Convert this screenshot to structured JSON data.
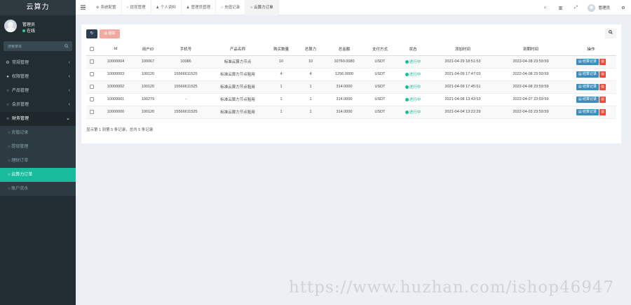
{
  "app": {
    "brand": "云算力"
  },
  "user": {
    "name": "管理员",
    "status": "在线"
  },
  "sidebar": {
    "search_placeholder": "搜索菜单",
    "menu": [
      {
        "label": "常规管理",
        "icon": "cogs-icon"
      },
      {
        "label": "权限管理",
        "icon": "group-icon"
      },
      {
        "label": "产品管理",
        "icon": "circle-icon"
      },
      {
        "label": "会员管理",
        "icon": "circle-icon"
      },
      {
        "label": "财务管理",
        "icon": "circle-icon"
      }
    ],
    "submenu": [
      {
        "label": "充值记录"
      },
      {
        "label": "提现管理"
      },
      {
        "label": "理财订单"
      },
      {
        "label": "云算力订单"
      },
      {
        "label": "账户流水"
      }
    ]
  },
  "topbar": {
    "tabs": [
      {
        "label": "系统配置"
      },
      {
        "label": "提现管理"
      },
      {
        "label": "个人资料"
      },
      {
        "label": "管理员管理"
      },
      {
        "label": "充值记录"
      },
      {
        "label": "云算力订单"
      }
    ],
    "user_label": "管理员"
  },
  "toolbar": {
    "delete_label": "删除"
  },
  "table": {
    "headers": [
      "Id",
      "用户ID",
      "手机号",
      "产品名称",
      "购买数量",
      "总算力",
      "总金额",
      "支付方式",
      "状态",
      "添加时间",
      "到期时间",
      "操作"
    ],
    "rows": [
      {
        "id": "10000004",
        "user_id": "100067",
        "phone": "10086",
        "product": "标准云算力节点",
        "qty": "10",
        "power": "10",
        "amount": "10760.0080",
        "pay": "USDT",
        "status": "进行中",
        "added": "2021-04-29 18:51:53",
        "expire": "2023-04-28 23:59:59"
      },
      {
        "id": "10000003",
        "user_id": "100120",
        "phone": "15566611525",
        "product": "标准云算力节点租用",
        "qty": "4",
        "power": "4",
        "amount": "1256.0000",
        "pay": "USDT",
        "status": "进行中",
        "added": "2021-04-09 17:47:03",
        "expire": "2022-04-08 23:59:59"
      },
      {
        "id": "10000002",
        "user_id": "100120",
        "phone": "15566611525",
        "product": "标准云算力节点租用",
        "qty": "1",
        "power": "1",
        "amount": "314.0000",
        "pay": "USDT",
        "status": "进行中",
        "added": "2021-04-09 17:45:51",
        "expire": "2022-04-08 23:59:59"
      },
      {
        "id": "10000001",
        "user_id": "100279",
        "phone": "-",
        "product": "标准云算力节点租用",
        "qty": "1",
        "power": "1",
        "amount": "314.0000",
        "pay": "USDT",
        "status": "进行中",
        "added": "2021-04-08 13:43:53",
        "expire": "2022-04-07 23:59:59"
      },
      {
        "id": "10000000",
        "user_id": "100120",
        "phone": "15566611525",
        "product": "标准云算力节点租用",
        "qty": "1",
        "power": "1",
        "amount": "314.0000",
        "pay": "USDT",
        "status": "进行中",
        "added": "2021-04-04 13:22:29",
        "expire": "2022-04-03 23:59:59"
      }
    ],
    "record_label": "结算记录",
    "footer": "显示第 1 到第 5 条记录，总共 5 条记录"
  },
  "watermark": "https://www.huzhan.com/ishop46947",
  "colors": {
    "sidebar_bg": "#222d32",
    "accent": "#18bc9c",
    "primary_dark": "#2c3e50",
    "danger": "#e74c3c",
    "info": "#3c8dbc"
  }
}
